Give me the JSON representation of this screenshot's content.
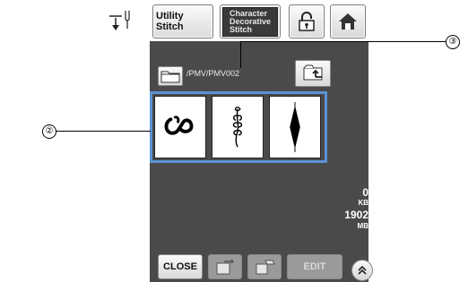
{
  "toolbar": {
    "utility_label": "Utility\nStitch",
    "character_label": "Character\nDecorative\nStitch"
  },
  "browser": {
    "path": "/PMV/PMV002",
    "patterns": [
      "scroll-s-pattern",
      "leaf-sprig-pattern",
      "diamond-satin-pattern"
    ]
  },
  "memory": {
    "used_value": "0",
    "used_unit": "KB",
    "free_value": "1902",
    "free_unit": "MB"
  },
  "bottom": {
    "close_label": "CLOSE",
    "edit_label": "EDIT"
  },
  "callouts": {
    "patterns": "②",
    "path": "③"
  },
  "colors": {
    "panel": "#4a4a4a",
    "selection": "#5b93d3"
  }
}
